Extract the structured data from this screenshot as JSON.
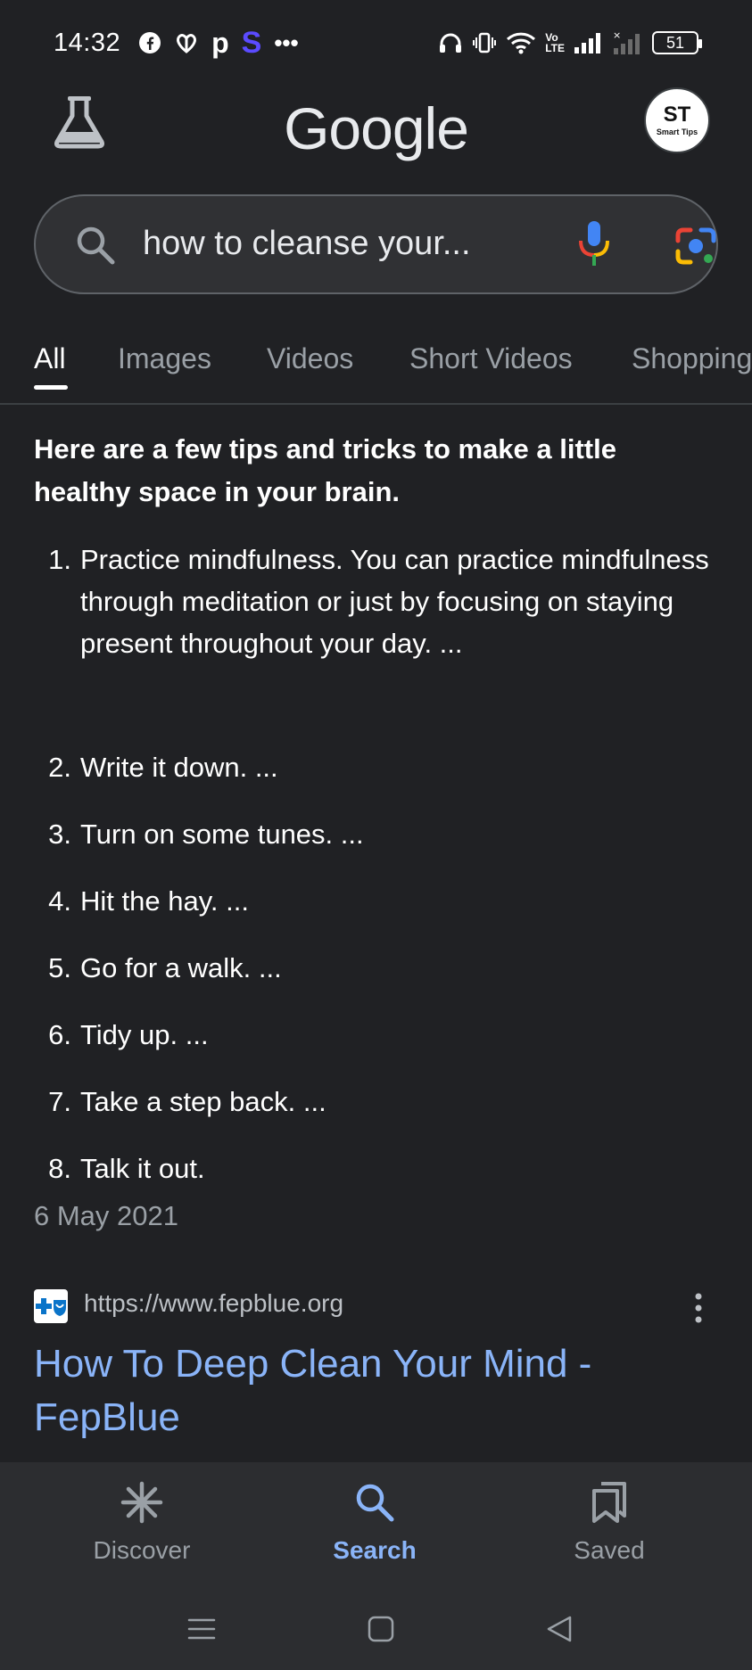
{
  "status_bar": {
    "time": "14:32",
    "battery": "51",
    "left_icons": [
      "facebook-icon",
      "heart-app-icon",
      "p-app-icon",
      "s-app-icon",
      "more-dots-icon"
    ],
    "right_icons": [
      "headphones-icon",
      "vibrate-icon",
      "wifi-icon",
      "volte-icon",
      "signal-icon",
      "signal-no-service-icon",
      "battery-icon"
    ]
  },
  "header": {
    "logo": "Google",
    "avatar_mark": "ST",
    "avatar_text": "Smart Tips"
  },
  "search": {
    "query": "how to cleanse your..."
  },
  "tabs": [
    {
      "label": "All",
      "active": true
    },
    {
      "label": "Images",
      "active": false
    },
    {
      "label": "Videos",
      "active": false
    },
    {
      "label": "Short Videos",
      "active": false
    },
    {
      "label": "Shopping",
      "active": false
    }
  ],
  "snippet": {
    "intro": "Here are a few tips and tricks to make a little healthy space in your brain.",
    "tips": [
      {
        "num": "1.",
        "text": "Practice mindfulness. You can practice mindfulness through meditation or just by focusing on staying present throughout your day. ..."
      },
      {
        "num": "2.",
        "text": "Write it down. ..."
      },
      {
        "num": "3.",
        "text": "Turn on some tunes. ..."
      },
      {
        "num": "4.",
        "text": "Hit the hay. ..."
      },
      {
        "num": "5.",
        "text": "Go for a walk. ..."
      },
      {
        "num": "6.",
        "text": "Tidy up. ..."
      },
      {
        "num": "7.",
        "text": "Take a step back. ..."
      },
      {
        "num": "8.",
        "text": "Talk it out."
      }
    ],
    "date": "6 May 2021"
  },
  "result": {
    "url": "https://www.fepblue.org",
    "title": "How To Deep Clean Your Mind - FepBlue"
  },
  "bottom_nav": [
    {
      "label": "Discover",
      "icon": "discover-asterisk-icon",
      "active": false
    },
    {
      "label": "Search",
      "icon": "search-icon",
      "active": true
    },
    {
      "label": "Saved",
      "icon": "saved-bookmarks-icon",
      "active": false
    }
  ],
  "colors": {
    "background": "#202124",
    "link": "#8ab4f8",
    "muted": "#9aa0a6"
  }
}
